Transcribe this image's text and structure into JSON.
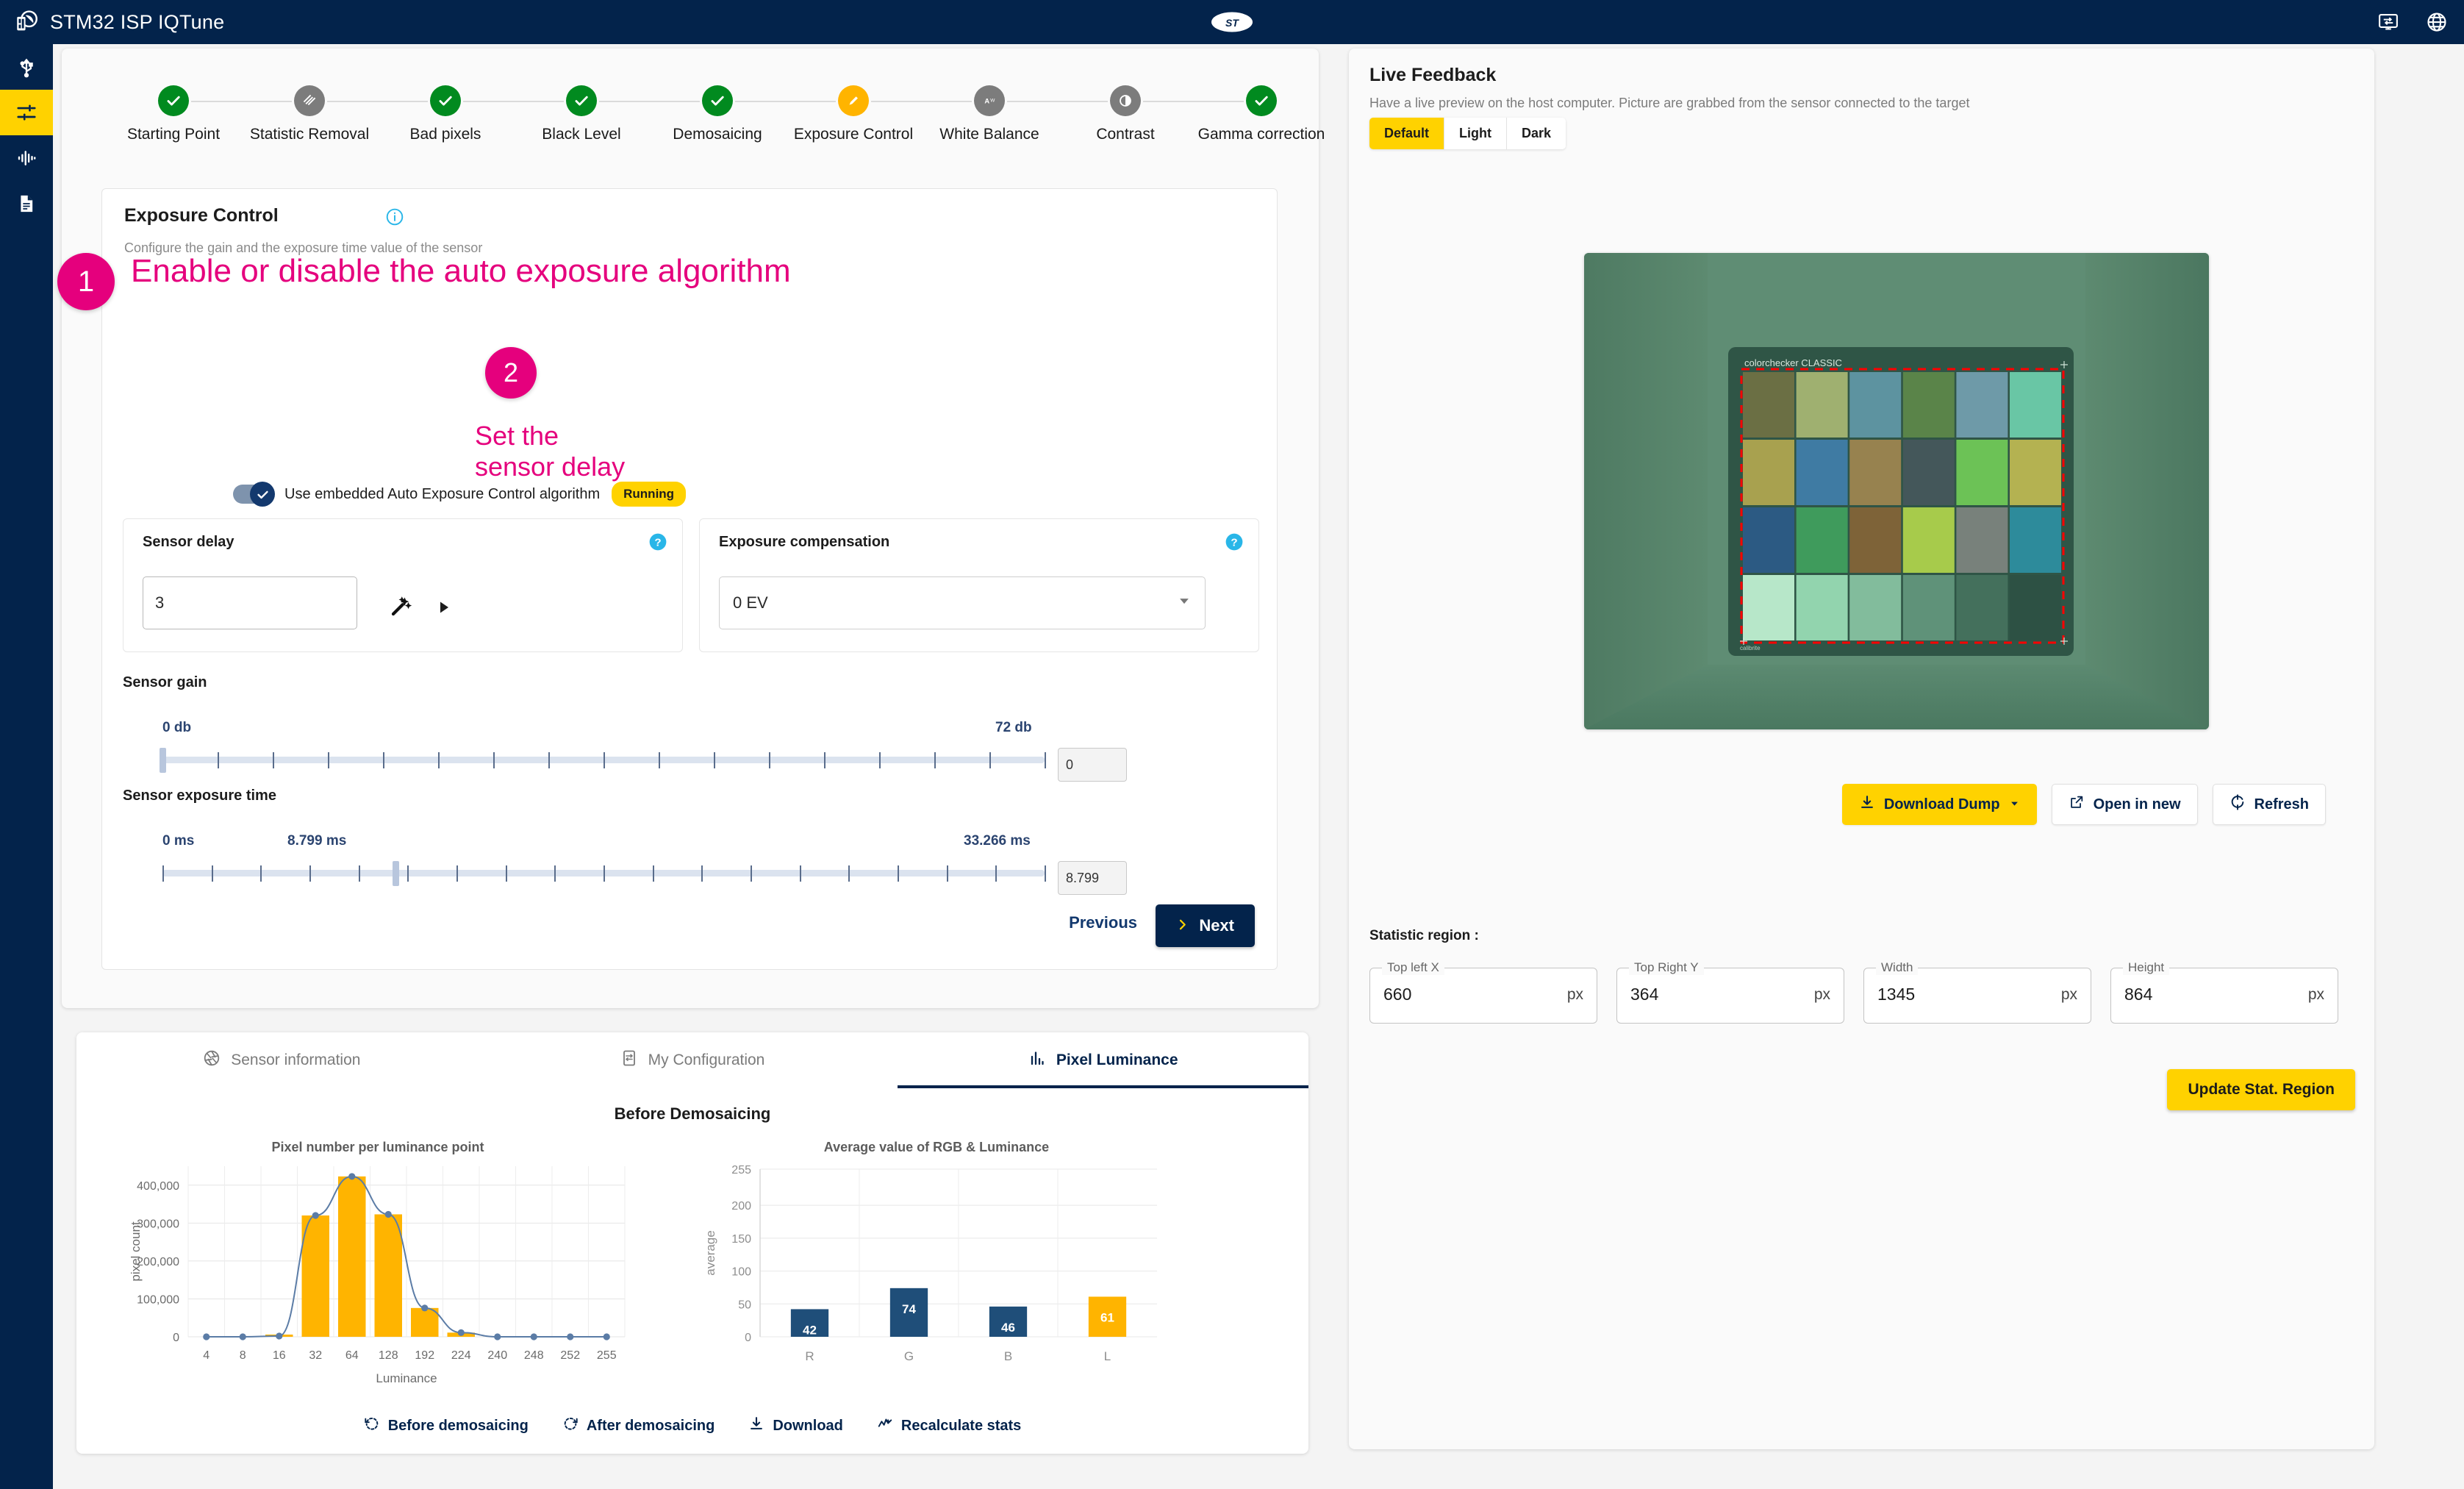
{
  "app": {
    "title": "STM32 ISP IQTune",
    "logo_icon": "stm32-camera-logo",
    "brand_icon": "st-logo",
    "topbar_icons": [
      {
        "name": "monitor-config-icon"
      },
      {
        "name": "globe-icon"
      }
    ],
    "brand_color": "#03234b",
    "accent_color": "#ffd200"
  },
  "rail": {
    "items": [
      {
        "name": "usb-icon",
        "active": false
      },
      {
        "name": "sliders-icon",
        "active": true
      },
      {
        "name": "waveform-icon",
        "active": false
      },
      {
        "name": "document-icon",
        "active": false
      }
    ]
  },
  "stepper": {
    "steps": [
      {
        "label": "Starting Point",
        "state": "done",
        "icon": "check-icon"
      },
      {
        "label": "Statistic Removal",
        "state": "skipped",
        "icon": "hatch-icon"
      },
      {
        "label": "Bad pixels",
        "state": "done",
        "icon": "check-icon"
      },
      {
        "label": "Black Level",
        "state": "done",
        "icon": "check-icon"
      },
      {
        "label": "Demosaicing",
        "state": "done",
        "icon": "check-icon"
      },
      {
        "label": "Exposure Control",
        "state": "current",
        "icon": "pencil-icon"
      },
      {
        "label": "White Balance",
        "state": "todo",
        "icon": "awb-icon"
      },
      {
        "label": "Contrast",
        "state": "todo",
        "icon": "contrast-icon"
      },
      {
        "label": "Gamma correction",
        "state": "done",
        "icon": "check-icon"
      }
    ]
  },
  "panel": {
    "title": "Exposure Control",
    "info_icon": "info-icon",
    "subtitle": "Configure the gain and the exposure time value of the sensor",
    "toggle": {
      "label": "Use embedded Auto Exposure Control algorithm",
      "checked": true,
      "badge": "Running"
    },
    "sensor_delay": {
      "title": "Sensor delay",
      "value": "3",
      "help_icon": "help-icon",
      "wand_icon": "magic-wand-icon",
      "play_icon": "play-icon"
    },
    "exposure_compensation": {
      "title": "Exposure compensation",
      "value": "0 EV",
      "help_icon": "help-icon",
      "caret_icon": "chevron-down-icon"
    },
    "sensor_gain": {
      "label": "Sensor gain",
      "min_label": "0 db",
      "max_label": "72 db",
      "value": "0",
      "min": 0,
      "max": 72,
      "current": 0
    },
    "sensor_exposure_time": {
      "label": "Sensor exposure time",
      "min_label": "0 ms",
      "current_label": "8.799 ms",
      "max_label": "33.266 ms",
      "value": "8.799",
      "min": 0,
      "max": 33.266,
      "current": 8.799
    },
    "nav": {
      "previous": "Previous",
      "next": "Next",
      "next_icon": "chevron-right-icon"
    }
  },
  "annotations": [
    {
      "number": "1",
      "text": "Enable or disable the auto exposure algorithm"
    },
    {
      "number": "2",
      "text": "Set the\nsensor delay"
    }
  ],
  "live_feedback": {
    "title": "Live Feedback",
    "subtitle": "Have a live preview on the host computer. Picture are grabbed from the sensor connected to the target",
    "themes": [
      {
        "label": "Default",
        "active": true
      },
      {
        "label": "Light",
        "active": false
      },
      {
        "label": "Dark",
        "active": false
      }
    ],
    "preview": {
      "name": "colorchecker-classic-preview",
      "caption": "colorchecker CLASSIC",
      "brand": "calibrite",
      "roi_color": "#ff0000"
    },
    "buttons": [
      {
        "label": "Download Dump",
        "icon": "download-icon",
        "style": "yellow",
        "caret": true
      },
      {
        "label": "Open in new",
        "icon": "external-link-icon",
        "style": "plain",
        "caret": false
      },
      {
        "label": "Refresh",
        "icon": "refresh-icon",
        "style": "plain",
        "caret": false
      }
    ],
    "statistic_region_label": "Statistic region :",
    "fields": [
      {
        "legend": "Top left X",
        "value": "660",
        "unit": "px"
      },
      {
        "legend": "Top Right Y",
        "value": "364",
        "unit": "px"
      },
      {
        "legend": "Width",
        "value": "1345",
        "unit": "px"
      },
      {
        "legend": "Height",
        "value": "864",
        "unit": "px"
      }
    ],
    "update_button": "Update Stat. Region"
  },
  "bottom": {
    "tabs": [
      {
        "label": "Sensor information",
        "icon": "aperture-icon",
        "active": false
      },
      {
        "label": "My Configuration",
        "icon": "config-icon",
        "active": false
      },
      {
        "label": "Pixel Luminance",
        "icon": "bar-chart-icon",
        "active": true
      }
    ],
    "section_title": "Before Demosaicing",
    "actions": [
      {
        "label": "Before demosaicing",
        "icon": "rotate-ccw-icon"
      },
      {
        "label": "After demosaicing",
        "icon": "rotate-cw-icon"
      },
      {
        "label": "Download",
        "icon": "download-icon"
      },
      {
        "label": "Recalculate stats",
        "icon": "activity-icon"
      }
    ]
  },
  "chart_data": [
    {
      "type": "bar",
      "title": "Pixel number per luminance point",
      "xlabel": "Luminance",
      "ylabel": "pixel count",
      "categories": [
        "4",
        "8",
        "16",
        "32",
        "64",
        "128",
        "192",
        "224",
        "240",
        "248",
        "252",
        "255"
      ],
      "values": [
        0,
        0,
        2000,
        320000,
        423000,
        323000,
        76000,
        11000,
        0,
        0,
        0,
        0
      ],
      "ylim": [
        0,
        450000
      ],
      "yticks": [
        "0",
        "100,000",
        "200,000",
        "300,000",
        "400,000"
      ],
      "bar_color": "#ffb400",
      "line_color": "#5b7ca6",
      "overlay_line": true,
      "grid": true,
      "legend": "none"
    },
    {
      "type": "bar",
      "title": "Average value of RGB & Luminance",
      "xlabel": "",
      "ylabel": "average",
      "categories": [
        "R",
        "G",
        "B",
        "L"
      ],
      "values": [
        42,
        74,
        46,
        61
      ],
      "labels": [
        "42",
        "74",
        "46",
        "61"
      ],
      "ylim": [
        0,
        255
      ],
      "yticks": [
        "0",
        "50",
        "100",
        "150",
        "200",
        "255"
      ],
      "colors": [
        "#1f4e79",
        "#1f4e79",
        "#1f4e79",
        "#ffb400"
      ],
      "grid": true,
      "legend": "none"
    }
  ]
}
